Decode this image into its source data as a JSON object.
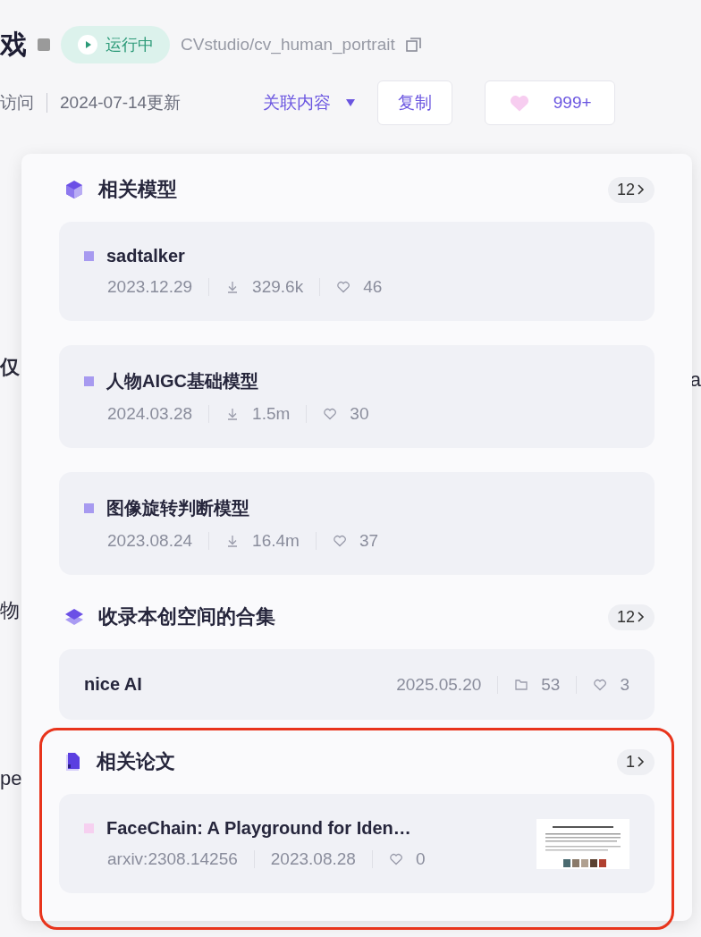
{
  "header": {
    "title_fragment": "戏",
    "status": "运行中",
    "repo": "CVstudio/cv_human_portrait",
    "visits_fragment": "访问",
    "updated": "2024-07-14更新",
    "related_menu": {
      "label": "关联内容",
      "expanded": true
    },
    "copy_button": "复制",
    "like_button": "999+"
  },
  "left_fragments": [
    "仅",
    "物",
    "pe"
  ],
  "right_fragments": [
    "a"
  ],
  "popup": {
    "sections": [
      {
        "kind": "models",
        "title": "相关模型",
        "count": "12",
        "highlighted": false,
        "items": [
          {
            "name": "sadtalker",
            "color": "#a79af0",
            "date": "2023.12.29",
            "downloads": "329.6k",
            "likes": "46"
          },
          {
            "name": "人物AIGC基础模型",
            "color": "#a79af0",
            "date": "2024.03.28",
            "downloads": "1.5m",
            "likes": "30"
          },
          {
            "name": "图像旋转判断模型",
            "color": "#a79af0",
            "date": "2023.08.24",
            "downloads": "16.4m",
            "likes": "37"
          }
        ]
      },
      {
        "kind": "collections",
        "title": "收录本创空间的合集",
        "count": "12",
        "highlighted": false,
        "items": [
          {
            "name": "nice AI",
            "date": "2025.05.20",
            "files": "53",
            "likes": "3"
          }
        ]
      },
      {
        "kind": "papers",
        "title": "相关论文",
        "count": "1",
        "highlighted": true,
        "items": [
          {
            "name": "FaceChain: A Playground for Iden…",
            "color": "#f6d0f0",
            "source": "arxiv:2308.14256",
            "date": "2023.08.28",
            "likes": "0"
          }
        ]
      }
    ]
  }
}
